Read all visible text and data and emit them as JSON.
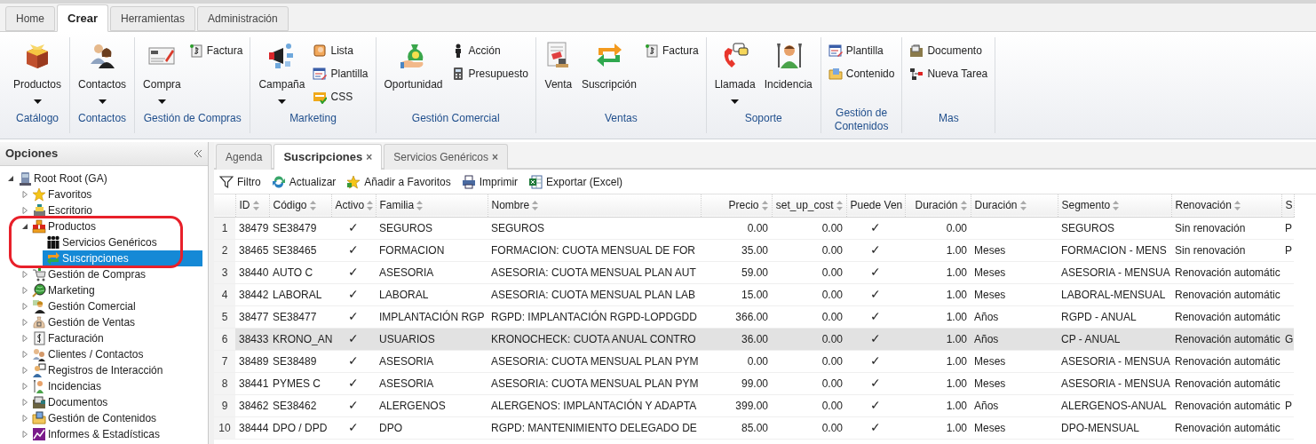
{
  "ribbon_tabs": [
    {
      "label": "Home",
      "selected": false
    },
    {
      "label": "Crear",
      "selected": true
    },
    {
      "label": "Herramientas",
      "selected": false
    },
    {
      "label": "Administración",
      "selected": false
    }
  ],
  "ribbon_groups": [
    {
      "label": "Catálogo",
      "big_buttons": [
        {
          "label": "Productos",
          "dropdown": true
        }
      ]
    },
    {
      "label": "Contactos",
      "big_buttons": [
        {
          "label": "Contactos",
          "dropdown": true
        }
      ]
    },
    {
      "label": "Gestión de Compras",
      "big_buttons": [
        {
          "label": "Compra",
          "dropdown": true
        }
      ],
      "small_buttons": [
        "Factura"
      ]
    },
    {
      "label": "Marketing",
      "big_buttons": [
        {
          "label": "Campaña",
          "dropdown": true
        }
      ],
      "small_buttons": [
        "Lista",
        "Plantilla",
        "CSS"
      ]
    },
    {
      "label": "Gestión Comercial",
      "big_buttons": [
        {
          "label": "Oportunidad",
          "dropdown": false
        }
      ],
      "small_buttons": [
        "Acción",
        "Presupuesto"
      ]
    },
    {
      "label": "Ventas",
      "big_buttons": [
        {
          "label": "Venta",
          "dropdown": false
        },
        {
          "label": "Suscripción",
          "dropdown": false
        }
      ],
      "small_buttons": [
        "Factura"
      ]
    },
    {
      "label": "Soporte",
      "big_buttons": [
        {
          "label": "Llamada",
          "dropdown": true
        },
        {
          "label": "Incidencia",
          "dropdown": false
        }
      ]
    },
    {
      "label": "Gestión de Contenidos",
      "small_buttons": [
        "Plantilla",
        "Contenido"
      ]
    },
    {
      "label": "Mas",
      "small_buttons": [
        "Documento",
        "Nueva Tarea"
      ]
    }
  ],
  "sidebar": {
    "title": "Opciones",
    "tree": [
      {
        "label": "Root Root (GA)",
        "kind": "folder",
        "expanded": true,
        "selected": false,
        "children": [
          {
            "label": "Favoritos",
            "kind": "folder",
            "expanded": false,
            "selected": false
          },
          {
            "label": "Escritorio",
            "kind": "folder",
            "expanded": false,
            "selected": false
          },
          {
            "label": "Productos",
            "kind": "folder",
            "expanded": true,
            "selected": false,
            "children": [
              {
                "label": "Servicios Genéricos",
                "kind": "leaf",
                "selected": false
              },
              {
                "label": "Suscripciones",
                "kind": "leaf",
                "selected": true
              }
            ]
          },
          {
            "label": "Gestión de Compras",
            "kind": "folder",
            "expanded": false,
            "selected": false
          },
          {
            "label": "Marketing",
            "kind": "folder",
            "expanded": false,
            "selected": false
          },
          {
            "label": "Gestión Comercial",
            "kind": "folder",
            "expanded": false,
            "selected": false
          },
          {
            "label": "Gestión de Ventas",
            "kind": "folder",
            "expanded": false,
            "selected": false
          },
          {
            "label": "Facturación",
            "kind": "folder",
            "expanded": false,
            "selected": false
          },
          {
            "label": "Clientes / Contactos",
            "kind": "folder",
            "expanded": false,
            "selected": false
          },
          {
            "label": "Registros de Interacción",
            "kind": "folder",
            "expanded": false,
            "selected": false
          },
          {
            "label": "Incidencias",
            "kind": "folder",
            "expanded": false,
            "selected": false
          },
          {
            "label": "Documentos",
            "kind": "folder",
            "expanded": false,
            "selected": false
          },
          {
            "label": "Gestión de Contenidos",
            "kind": "folder",
            "expanded": false,
            "selected": false
          },
          {
            "label": "Informes & Estadísticas",
            "kind": "folder",
            "expanded": false,
            "selected": false
          }
        ]
      }
    ]
  },
  "tabs": [
    {
      "label": "Agenda",
      "selected": false,
      "closable": false
    },
    {
      "label": "Suscripciones",
      "selected": true,
      "closable": true
    },
    {
      "label": "Servicios Genéricos",
      "selected": false,
      "closable": true
    }
  ],
  "close_glyph": "×",
  "toolbar": [
    "Filtro",
    "Actualizar",
    "Añadir a Favoritos",
    "Imprimir",
    "Exportar (Excel)"
  ],
  "table": {
    "columns": [
      {
        "label": "ID",
        "kind": "text"
      },
      {
        "label": "Código",
        "kind": "text"
      },
      {
        "label": "Activo",
        "kind": "check"
      },
      {
        "label": "Familia",
        "kind": "text"
      },
      {
        "label": "Nombre",
        "kind": "text"
      },
      {
        "label": "Precio",
        "kind": "number"
      },
      {
        "label": "set_up_cost",
        "kind": "number"
      },
      {
        "label": "Puede Ven",
        "kind": "check"
      },
      {
        "label": "Duración",
        "kind": "number"
      },
      {
        "label": "Duración",
        "kind": "text"
      },
      {
        "label": "Segmento",
        "kind": "text"
      },
      {
        "label": "Renovación",
        "kind": "text"
      },
      {
        "label": "S",
        "kind": "text"
      }
    ],
    "rows": [
      {
        "number": "1",
        "selected": false,
        "cells": [
          "38479",
          "SE38479",
          "✓",
          "SEGUROS",
          "SEGUROS",
          "0.00",
          "0.00",
          "✓",
          "0.00",
          "",
          "SEGUROS",
          "Sin renovación",
          "P"
        ]
      },
      {
        "number": "2",
        "selected": false,
        "cells": [
          "38465",
          "SE38465",
          "✓",
          "FORMACION",
          "FORMACION: CUOTA MENSUAL DE FOR",
          "35.00",
          "0.00",
          "✓",
          "1.00",
          "Meses",
          "FORMACION - MENS",
          "Sin renovación",
          "P"
        ]
      },
      {
        "number": "3",
        "selected": false,
        "cells": [
          "38440",
          "AUTO C",
          "✓",
          "ASESORIA",
          "ASESORIA: CUOTA MENSUAL PLAN AUT",
          "59.00",
          "0.00",
          "✓",
          "1.00",
          "Meses",
          "ASESORIA - MENSUA",
          "Renovación automátic",
          ""
        ]
      },
      {
        "number": "4",
        "selected": false,
        "cells": [
          "38442",
          "LABORAL",
          "✓",
          "LABORAL",
          "ASESORIA: CUOTA MENSUAL PLAN LAB",
          "15.00",
          "0.00",
          "✓",
          "1.00",
          "Meses",
          "LABORAL-MENSUAL",
          "Renovación automátic",
          ""
        ]
      },
      {
        "number": "5",
        "selected": false,
        "cells": [
          "38477",
          "SE38477",
          "✓",
          "IMPLANTACIÓN RGP",
          "RGPD: IMPLANTACIÓN RGPD-LOPDGDD",
          "366.00",
          "0.00",
          "✓",
          "1.00",
          "Años",
          "RGPD - ANUAL",
          "Renovación automátic",
          ""
        ]
      },
      {
        "number": "6",
        "selected": true,
        "cells": [
          "38433",
          "KRONO_AN",
          "✓",
          "USUARIOS",
          "KRONOCHECK: CUOTA ANUAL CONTRO",
          "36.00",
          "0.00",
          "✓",
          "1.00",
          "Años",
          "CP - ANUAL",
          "Renovación automátic",
          "G"
        ]
      },
      {
        "number": "7",
        "selected": false,
        "cells": [
          "38489",
          "SE38489",
          "✓",
          "ASESORIA",
          "ASESORIA: CUOTA MENSUAL PLAN PYM",
          "0.00",
          "0.00",
          "✓",
          "1.00",
          "Meses",
          "ASESORIA - MENSUA",
          "Renovación automátic",
          ""
        ]
      },
      {
        "number": "8",
        "selected": false,
        "cells": [
          "38441",
          "PYMES C",
          "✓",
          "ASESORIA",
          "ASESORIA: CUOTA MENSUAL PLAN PYM",
          "99.00",
          "0.00",
          "✓",
          "1.00",
          "Meses",
          "ASESORIA - MENSUA",
          "Renovación automátic",
          ""
        ]
      },
      {
        "number": "9",
        "selected": false,
        "cells": [
          "38462",
          "SE38462",
          "✓",
          "ALERGENOS",
          "ALERGENOS: IMPLANTACIÓN Y ADAPTA",
          "399.00",
          "0.00",
          "✓",
          "1.00",
          "Años",
          "ALERGENOS-ANUAL",
          "Renovación automátic",
          "P"
        ]
      },
      {
        "number": "10",
        "selected": false,
        "cells": [
          "38444",
          "DPO / DPD",
          "✓",
          "DPO",
          "RGPD: MANTENIMIENTO DELEGADO DE",
          "85.00",
          "0.00",
          "✓",
          "1.00",
          "Meses",
          "DPO-MENSUAL",
          "Renovación automátic",
          ""
        ]
      }
    ]
  }
}
